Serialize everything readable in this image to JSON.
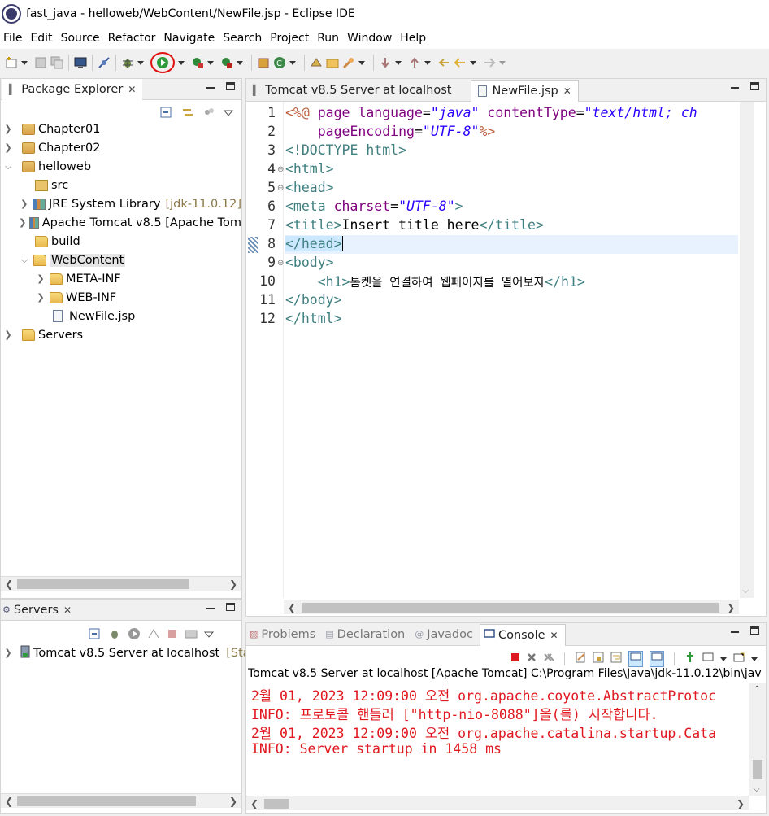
{
  "window": {
    "title": "fast_java - helloweb/WebContent/NewFile.jsp - Eclipse IDE"
  },
  "menu": [
    "File",
    "Edit",
    "Source",
    "Refactor",
    "Navigate",
    "Search",
    "Project",
    "Run",
    "Window",
    "Help"
  ],
  "package_explorer": {
    "tab": "Package Explorer",
    "items": [
      {
        "label": "Chapter01",
        "expanded": false,
        "icon": "project-icon"
      },
      {
        "label": "Chapter02",
        "expanded": false,
        "icon": "project-icon"
      },
      {
        "label": "helloweb",
        "expanded": true,
        "icon": "project-icon"
      },
      {
        "label": "src",
        "icon": "source-folder-icon"
      },
      {
        "label": "JRE System Library",
        "suffix": "[jdk-11.0.12]",
        "icon": "library-icon"
      },
      {
        "label": "Apache Tomcat v8.5 [Apache Tom",
        "icon": "library-icon"
      },
      {
        "label": "build",
        "icon": "folder-icon"
      },
      {
        "label": "WebContent",
        "icon": "folder-icon",
        "selected": true
      },
      {
        "label": "META-INF",
        "icon": "folder-icon"
      },
      {
        "label": "WEB-INF",
        "icon": "folder-icon"
      },
      {
        "label": "NewFile.jsp",
        "icon": "jsp-file-icon"
      },
      {
        "label": "Servers",
        "icon": "folder-icon"
      }
    ]
  },
  "servers": {
    "tab": "Servers",
    "entry": "Tomcat v8.5 Server at localhost",
    "entry_status": "[Star"
  },
  "editor": {
    "tabs": [
      {
        "label": "Tomcat v8.5 Server at localhost",
        "active": false
      },
      {
        "label": "NewFile.jsp",
        "active": true
      }
    ],
    "current_line": 8,
    "line_numbers": [
      "1",
      "2",
      "3",
      "4",
      "5",
      "6",
      "7",
      "8",
      "9",
      "10",
      "11",
      "12"
    ]
  },
  "bottom": {
    "tabs": [
      "Problems",
      "Declaration",
      "Javadoc",
      "Console"
    ],
    "active_tab": "Console",
    "console_header": "Tomcat v8.5 Server at localhost [Apache Tomcat] C:\\Program Files\\Java\\jdk-11.0.12\\bin\\jav",
    "console_lines": [
      "2월 01, 2023 12:09:00 오전 org.apache.coyote.AbstractProtoc",
      "INFO: 프로토콜 핸들러 [\"http-nio-8088\"]을(를) 시작합니다.",
      "2월 01, 2023 12:09:00 오전 org.apache.catalina.startup.Cata",
      "INFO: Server startup in 1458 ms"
    ]
  },
  "colors": {
    "console_error": "#e0181f",
    "selection": "#cce8ff",
    "current_line": "#e8f2fe"
  }
}
